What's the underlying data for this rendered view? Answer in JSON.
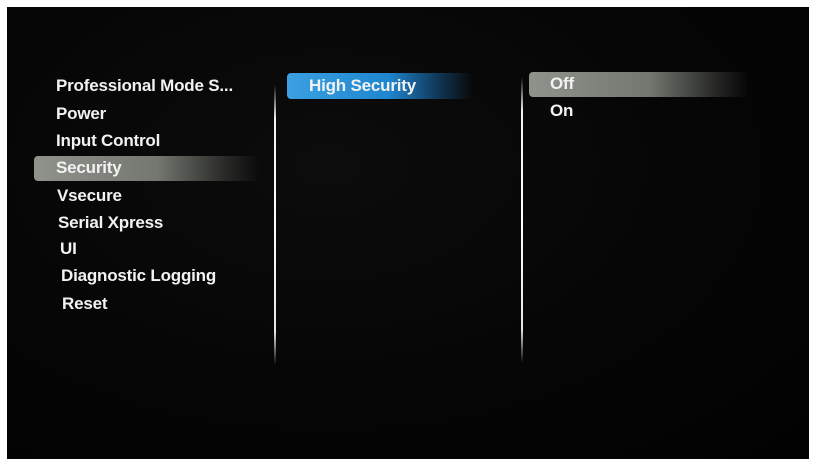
{
  "menu": {
    "items": [
      {
        "label": "Professional Mode S...",
        "selected": false
      },
      {
        "label": "Power",
        "selected": false
      },
      {
        "label": "Input Control",
        "selected": false
      },
      {
        "label": "Security",
        "selected": true
      },
      {
        "label": "Vsecure",
        "selected": false
      },
      {
        "label": "Serial Xpress",
        "selected": false
      },
      {
        "label": "UI",
        "selected": false
      },
      {
        "label": "Diagnostic Logging",
        "selected": false
      },
      {
        "label": "Reset",
        "selected": false
      }
    ]
  },
  "submenu": {
    "items": [
      {
        "label": "High Security",
        "selected": true
      }
    ]
  },
  "options": {
    "items": [
      {
        "label": "Off",
        "selected": true
      },
      {
        "label": "On",
        "selected": false
      }
    ]
  },
  "colors": {
    "selected_menu_highlight": "#8f938c",
    "selected_submenu_highlight": "#3aa0e2",
    "background": "#050505",
    "text": "#f2f2f2"
  }
}
